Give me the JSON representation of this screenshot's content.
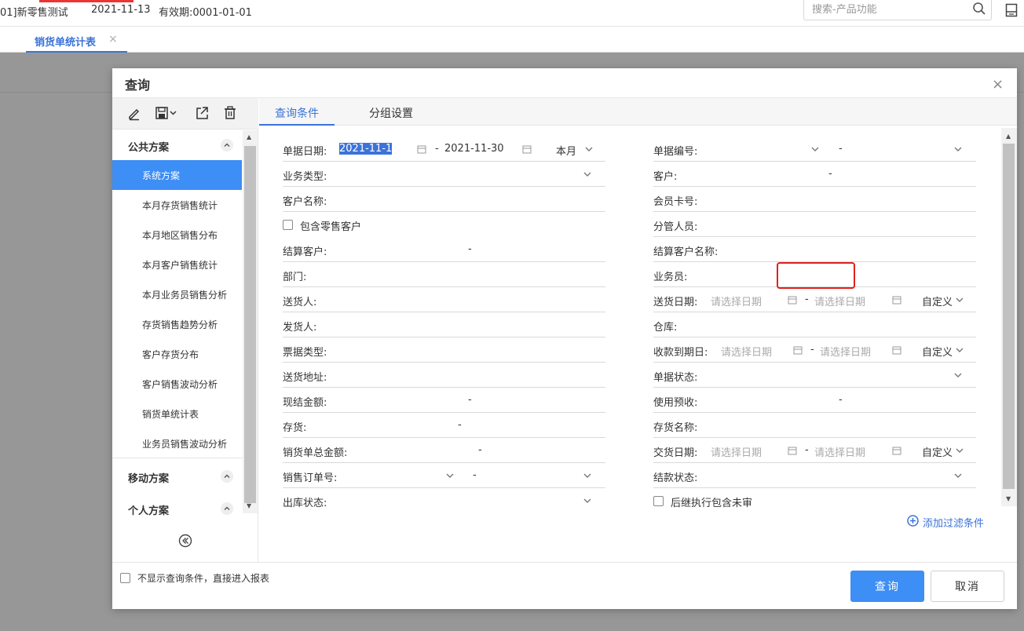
{
  "topbar": {
    "company": "01]新零售测试",
    "date": "2021-11-13",
    "validity": "有效期:0001-01-01",
    "search_placeholder": "搜索-产品功能"
  },
  "tabbar": {
    "tab_label": "销货单统计表",
    "tab_close": "×"
  },
  "dialog": {
    "title": "查询",
    "close": "×",
    "left": {
      "groups": {
        "public": "公共方案",
        "mobile": "移动方案",
        "personal": "个人方案"
      },
      "items": [
        "系统方案",
        "本月存货销售统计",
        "本月地区销售分布",
        "本月客户销售统计",
        "本月业务员销售分析",
        "存货销售趋势分析",
        "客户存货分布",
        "客户销售波动分析",
        "销货单统计表",
        "业务员销售波动分析"
      ]
    },
    "tabs": {
      "conditions": "查询条件",
      "grouping": "分组设置"
    },
    "left_fields": {
      "doc_date": {
        "label": "单据日期:",
        "from": "2021-11-1",
        "sep": "-",
        "to": "2021-11-30",
        "period": "本月"
      },
      "biz_type": {
        "label": "业务类型:"
      },
      "cust_name": {
        "label": "客户名称:"
      },
      "retail": {
        "label": "包含零售客户"
      },
      "settle_cust": {
        "label": "结算客户:",
        "sep": "-"
      },
      "dept": {
        "label": "部门:"
      },
      "deliverer": {
        "label": "送货人:"
      },
      "shipper": {
        "label": "发货人:"
      },
      "invoice_type": {
        "label": "票据类型:"
      },
      "address": {
        "label": "送货地址:"
      },
      "cash_amt": {
        "label": "现结金额:",
        "sep": "-"
      },
      "stock": {
        "label": "存货:",
        "sep": "-"
      },
      "total_amt": {
        "label": "销货单总金额:",
        "sep": "-"
      },
      "order_no": {
        "label": "销售订单号:",
        "sep": "-"
      },
      "out_status": {
        "label": "出库状态:"
      }
    },
    "right_fields": {
      "doc_no": {
        "label": "单据编号:",
        "sep": "-"
      },
      "customer": {
        "label": "客户:",
        "sep": "-"
      },
      "member_card": {
        "label": "会员卡号:"
      },
      "manager": {
        "label": "分管人员:"
      },
      "settle_name": {
        "label": "结算客户名称:"
      },
      "salesman": {
        "label": "业务员:"
      },
      "delivery_date": {
        "label": "送货日期:",
        "ph1": "请选择日期",
        "sep": "-",
        "ph2": "请选择日期",
        "mode": "自定义"
      },
      "warehouse": {
        "label": "仓库:"
      },
      "due_date": {
        "label": "收款到期日:",
        "ph1": "请选择日期",
        "sep": "-",
        "ph2": "请选择日期",
        "mode": "自定义"
      },
      "doc_status": {
        "label": "单据状态:"
      },
      "prepay": {
        "label": "使用预收:",
        "sep": "-"
      },
      "stock_name": {
        "label": "存货名称:"
      },
      "trade_date": {
        "label": "交货日期:",
        "ph1": "请选择日期",
        "sep": "-",
        "ph2": "请选择日期",
        "mode": "自定义"
      },
      "pay_status": {
        "label": "结款状态:"
      },
      "follow": {
        "label": "后继执行包含未审"
      }
    },
    "add_filter": "添加过滤条件",
    "footer": {
      "skip_label": "不显示查询条件，直接进入报表",
      "query": "查询",
      "cancel": "取消"
    }
  },
  "colors": {
    "accent": "#3b73d9",
    "primary_button": "#3d8ef5",
    "highlight": "#e0201b",
    "overlay": "#979797"
  }
}
